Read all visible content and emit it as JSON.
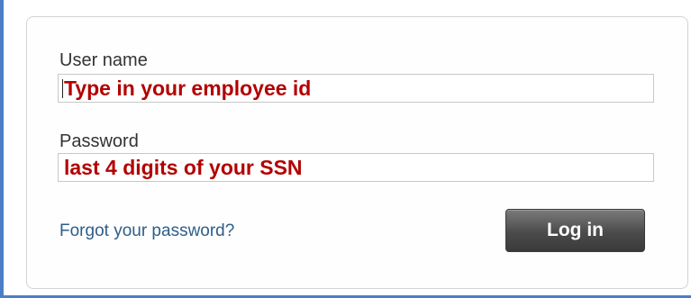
{
  "login_form": {
    "username_label": "User name",
    "username_placeholder": "Type in your employee id",
    "password_label": "Password",
    "password_placeholder": "last 4 digits of your SSN",
    "forgot_password_link": "Forgot your password?",
    "login_button_label": "Log in"
  },
  "colors": {
    "frame_border": "#4a7fc8",
    "placeholder_text": "#b20000",
    "link": "#2d5e89",
    "button_background": "#4b4b4b"
  }
}
